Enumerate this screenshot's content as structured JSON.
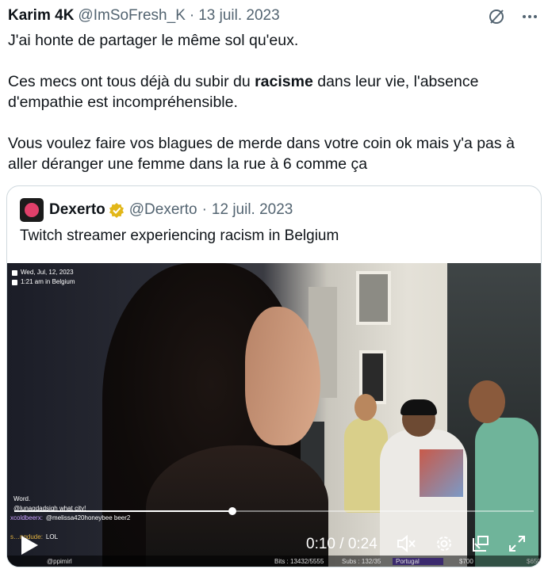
{
  "tweet": {
    "author_name": "Karim 4K",
    "author_handle": "@ImSoFresh_K",
    "separator": "·",
    "date": "13 juil. 2023",
    "paragraph1": "J'ai honte de partager le même sol qu'eux.",
    "paragraph2_before": "Ces mecs ont tous déjà du subir du ",
    "paragraph2_bold": "racisme",
    "paragraph2_after": " dans leur vie, l'absence d'empathie est incompréhensible.",
    "paragraph3": "Vous voulez faire vos blagues de merde dans votre coin ok mais y'a pas à aller déranger une femme dans la rue à 6 comme ça"
  },
  "icons": {
    "grok": "grok-icon",
    "more": "more-icon",
    "verified": "verified-badge-icon",
    "play": "play-icon",
    "mute": "mute-icon",
    "settings": "gear-icon",
    "pip": "picture-in-picture-icon",
    "fullscreen": "fullscreen-icon"
  },
  "colors": {
    "secondary_text": "#536471",
    "border": "#cfd9de",
    "verified_gold": "#e2b719"
  },
  "quote": {
    "author_name": "Dexerto",
    "author_handle": "@Dexerto",
    "separator": "·",
    "date": "12 juil. 2023",
    "text": "Twitch streamer experiencing racism in Belgium"
  },
  "video": {
    "overlay_date": "Wed, Jul, 12, 2023",
    "overlay_time": "1:21 am in Belgium",
    "current_time": "0:10",
    "time_separator": "/",
    "duration": "0:24",
    "progress": 0.42,
    "chat": [
      {
        "user": "",
        "message": "Word."
      },
      {
        "user": "",
        "message": "@lunagdadsigh what city!"
      },
      {
        "user": "xcoldbeerx:",
        "message": "@melissa420honeybee beer2"
      },
      {
        "user": "",
        "message": ""
      },
      {
        "user": "s…ngdude:",
        "message": "LOL"
      }
    ],
    "bottom_bar": {
      "handle": "@ppimirl",
      "bits": "Bits : 13432/5555",
      "subs": "Subs : 132/35",
      "country": "Portugal",
      "goal1": "$700",
      "goal2": "$650"
    }
  }
}
